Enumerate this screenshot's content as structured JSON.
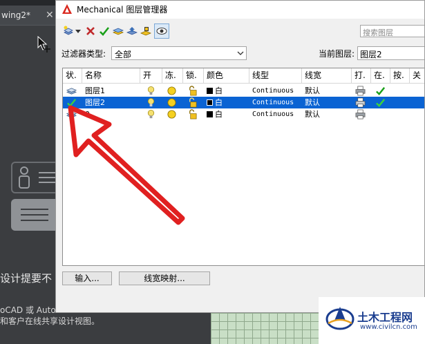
{
  "background": {
    "tab_label": "wing2*",
    "tab_close": "✕",
    "text_line_1": "设计提要不",
    "text_line_2": "oCAD 或 AutoC",
    "text_line_3": "和客户在线共享设计视图。"
  },
  "dialog": {
    "title": "Mechanical 图层管理器",
    "search_placeholder": "搜索图层",
    "filter_label": "过滤器类型:",
    "filter_value": "全部",
    "current_layer_label": "当前图层:",
    "current_layer_value": "图层2",
    "toolbar_icons": [
      "new-layer-icon",
      "dropdown-icon",
      "delete-icon",
      "set-current-icon",
      "layer-state-icon",
      "layer-walk-icon",
      "isolate-icon",
      "view-icon"
    ],
    "columns": [
      "状.",
      "名称",
      "开",
      "冻.",
      "锁.",
      "颜色",
      "线型",
      "线宽",
      "打.",
      "在.",
      "按.",
      "关"
    ],
    "rows": [
      {
        "name": "图层1",
        "color": "白",
        "linetype": "Continuous",
        "lineweight": "默认",
        "status": "layer",
        "selected": false,
        "in_use": true
      },
      {
        "name": "图层2",
        "color": "白",
        "linetype": "Continuous",
        "lineweight": "默认",
        "status": "current",
        "selected": true,
        "in_use": true
      },
      {
        "name": "0",
        "color": "白",
        "linetype": "Continuous",
        "lineweight": "默认",
        "status": "layer",
        "selected": false,
        "in_use": false
      }
    ],
    "buttons": {
      "import": "输入...",
      "lineweight_map": "线宽映射..."
    }
  },
  "watermark": {
    "title": "土木工程网",
    "url": "www.civilcn.com"
  },
  "colors": {
    "selection": "#0a63d3",
    "arrow": "#e02020",
    "check": "#1aa01a"
  }
}
